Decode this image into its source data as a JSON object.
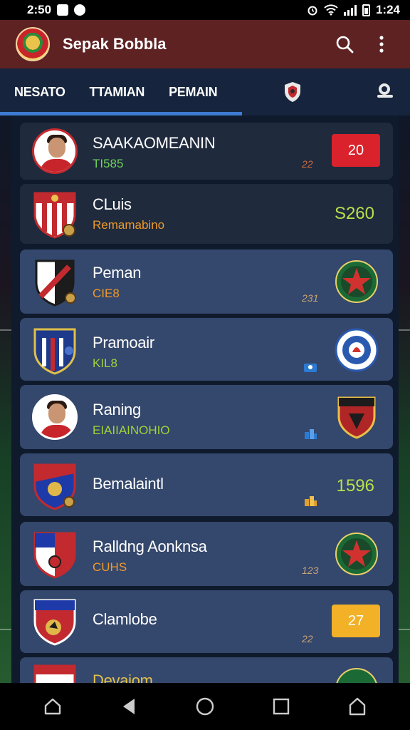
{
  "status_bar": {
    "time": "2:50",
    "right_text": "1:24"
  },
  "app_bar": {
    "title": "Sepak Bobbla"
  },
  "tabs": [
    {
      "label": "NESATO"
    },
    {
      "label": "TTAMIAN"
    },
    {
      "label": "PEMAIN"
    }
  ],
  "items": [
    {
      "name": "SAAKAOMEANIN",
      "sub": "TI585",
      "small": "22",
      "badge": "20"
    },
    {
      "name": "CLuis",
      "sub": "Remamabino",
      "value": "S260"
    },
    {
      "name": "Peman",
      "sub": "CIE8",
      "small": "231"
    },
    {
      "name": "Pramoair",
      "sub": "KIL8"
    },
    {
      "name": "Raning",
      "sub": "EIAIIAINOHIO"
    },
    {
      "name": "Bemalaintl",
      "value": "1596"
    },
    {
      "name": "Ralldng Aonknsa",
      "sub": "CUHS",
      "small": "123"
    },
    {
      "name": "Clamlobe",
      "small": "22",
      "badge": "27"
    },
    {
      "name": "Devaiom"
    }
  ],
  "colors": {
    "app_bar": "#5e2223",
    "tab_bar": "#16253d",
    "tab_indicator": "#3d7bd1",
    "card_blue": "#34476c",
    "badge_red": "#d9222b",
    "badge_yellow": "#f2b127"
  },
  "icons": {
    "search": "search-icon",
    "more": "more-vert-icon",
    "nav": [
      "home-icon",
      "back-icon",
      "circle-home-icon",
      "recents-icon",
      "house-icon"
    ]
  }
}
